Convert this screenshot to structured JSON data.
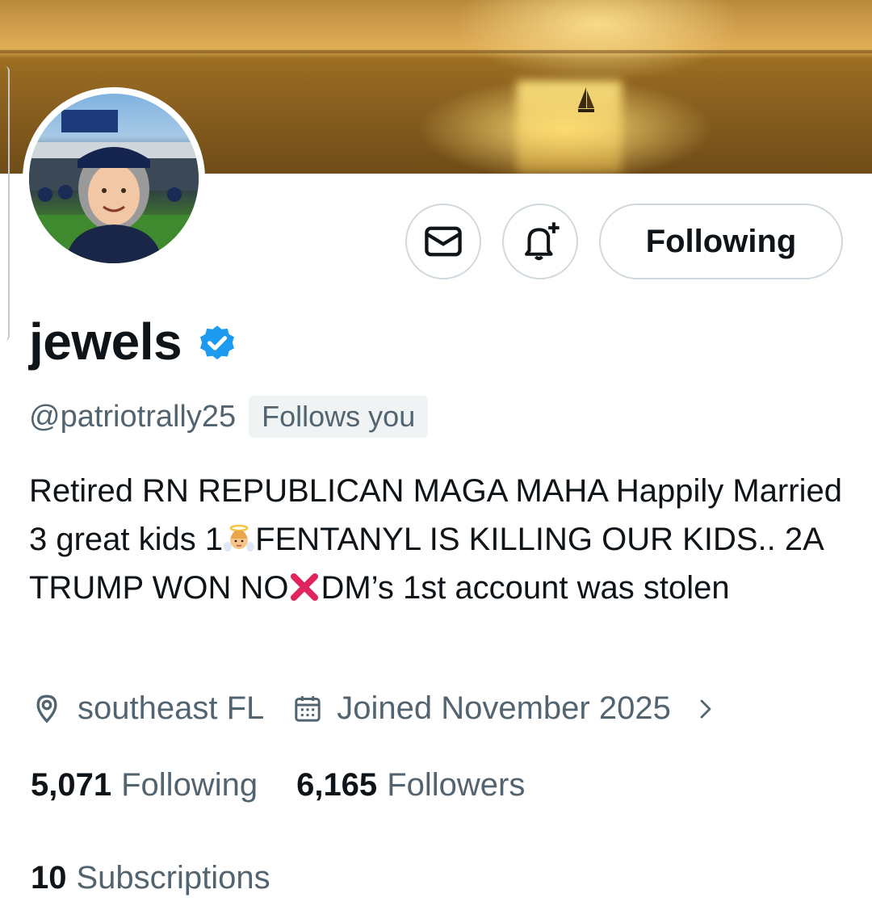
{
  "profile": {
    "display_name": "jewels",
    "verified": true,
    "handle": "@patriotrally25",
    "follows_you": "Follows you",
    "bio_parts": [
      "Retired RN REPUBLICAN MAGA MAHA Happily Married 3 great kids 1",
      "FENTANYL IS KILLING OUR KIDS.. 2A TRUMP WON NO",
      "DM’s 1st account was stolen"
    ],
    "location": "southeast FL",
    "joined": "Joined November 2025"
  },
  "actions": {
    "message_icon": "envelope-icon",
    "notify_icon": "bell-plus-icon",
    "follow_label": "Following"
  },
  "stats": {
    "following_count": "5,071",
    "following_label": "Following",
    "followers_count": "6,165",
    "followers_label": "Followers",
    "subscriptions_count": "10",
    "subscriptions_label": "Subscriptions"
  },
  "colors": {
    "text_primary": "#0f1419",
    "text_secondary": "#536471",
    "verified_blue": "#1d9bf0",
    "border": "#cfd9de"
  }
}
